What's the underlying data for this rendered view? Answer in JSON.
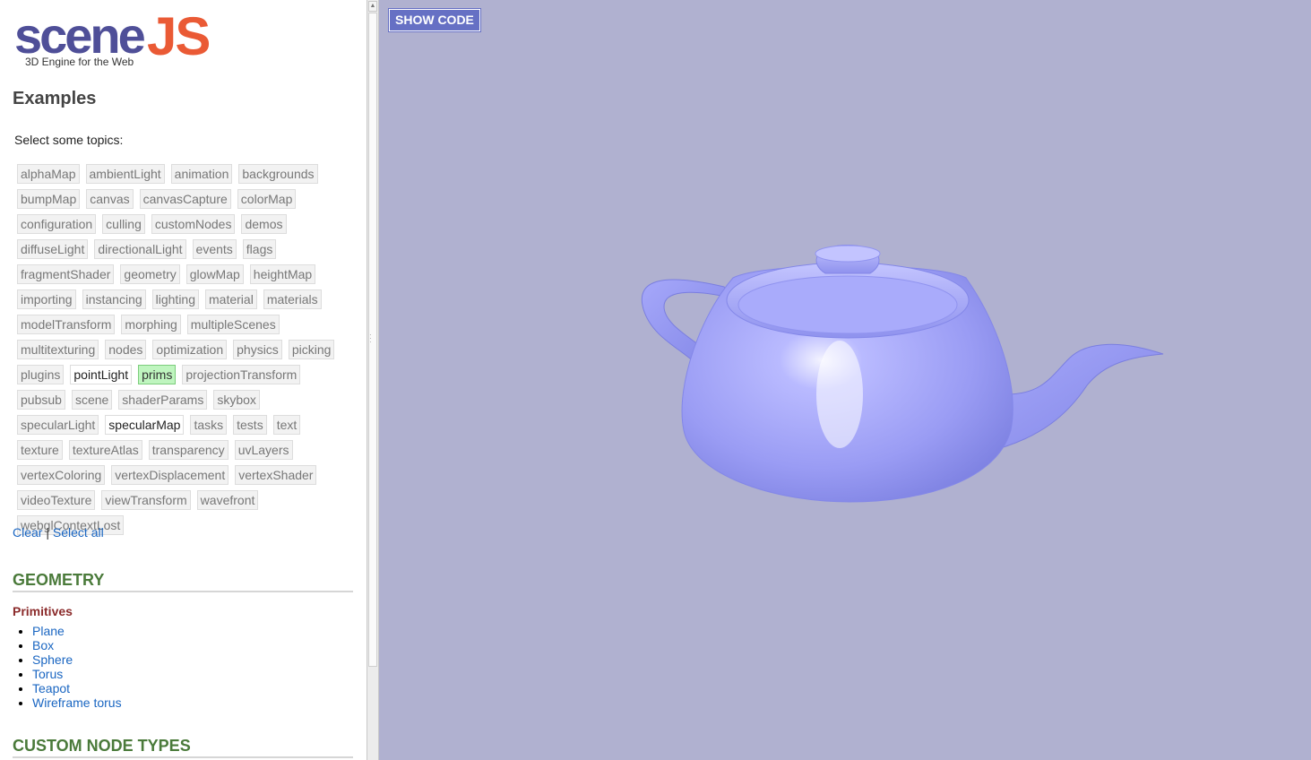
{
  "logo": {
    "scene": "scene",
    "js": "JS",
    "tagline": "3D Engine for the Web"
  },
  "page_title": "Examples",
  "prompt": "Select some topics:",
  "tags": [
    {
      "label": "alphaMap",
      "state": "off"
    },
    {
      "label": "ambientLight",
      "state": "off"
    },
    {
      "label": "animation",
      "state": "off"
    },
    {
      "label": "backgrounds",
      "state": "off"
    },
    {
      "label": "bumpMap",
      "state": "off"
    },
    {
      "label": "canvas",
      "state": "off"
    },
    {
      "label": "canvasCapture",
      "state": "off"
    },
    {
      "label": "colorMap",
      "state": "off"
    },
    {
      "label": "configuration",
      "state": "off"
    },
    {
      "label": "culling",
      "state": "off"
    },
    {
      "label": "customNodes",
      "state": "off"
    },
    {
      "label": "demos",
      "state": "off"
    },
    {
      "label": "diffuseLight",
      "state": "off"
    },
    {
      "label": "directionalLight",
      "state": "off"
    },
    {
      "label": "events",
      "state": "off"
    },
    {
      "label": "flags",
      "state": "off"
    },
    {
      "label": "fragmentShader",
      "state": "off"
    },
    {
      "label": "geometry",
      "state": "off"
    },
    {
      "label": "glowMap",
      "state": "off"
    },
    {
      "label": "heightMap",
      "state": "off"
    },
    {
      "label": "importing",
      "state": "off"
    },
    {
      "label": "instancing",
      "state": "off"
    },
    {
      "label": "lighting",
      "state": "off"
    },
    {
      "label": "material",
      "state": "off"
    },
    {
      "label": "materials",
      "state": "off"
    },
    {
      "label": "modelTransform",
      "state": "off"
    },
    {
      "label": "morphing",
      "state": "off"
    },
    {
      "label": "multipleScenes",
      "state": "off"
    },
    {
      "label": "multitexturing",
      "state": "off"
    },
    {
      "label": "nodes",
      "state": "off"
    },
    {
      "label": "optimization",
      "state": "off"
    },
    {
      "label": "physics",
      "state": "off"
    },
    {
      "label": "picking",
      "state": "off"
    },
    {
      "label": "plugins",
      "state": "off"
    },
    {
      "label": "pointLight",
      "state": "on"
    },
    {
      "label": "prims",
      "state": "selected"
    },
    {
      "label": "projectionTransform",
      "state": "off"
    },
    {
      "label": "pubsub",
      "state": "off"
    },
    {
      "label": "scene",
      "state": "off"
    },
    {
      "label": "shaderParams",
      "state": "off"
    },
    {
      "label": "skybox",
      "state": "off"
    },
    {
      "label": "specularLight",
      "state": "off"
    },
    {
      "label": "specularMap",
      "state": "on"
    },
    {
      "label": "tasks",
      "state": "off"
    },
    {
      "label": "tests",
      "state": "off"
    },
    {
      "label": "text",
      "state": "off"
    },
    {
      "label": "texture",
      "state": "off"
    },
    {
      "label": "textureAtlas",
      "state": "off"
    },
    {
      "label": "transparency",
      "state": "off"
    },
    {
      "label": "uvLayers",
      "state": "off"
    },
    {
      "label": "vertexColoring",
      "state": "off"
    },
    {
      "label": "vertexDisplacement",
      "state": "off"
    },
    {
      "label": "vertexShader",
      "state": "off"
    },
    {
      "label": "videoTexture",
      "state": "off"
    },
    {
      "label": "viewTransform",
      "state": "off"
    },
    {
      "label": "wavefront",
      "state": "off"
    },
    {
      "label": "webglContextLost",
      "state": "off"
    }
  ],
  "links": {
    "clear": "Clear",
    "separator": "|",
    "select_all": "Select all"
  },
  "sections": [
    {
      "title": "GEOMETRY",
      "subhead": "Primitives",
      "items": [
        "Plane",
        "Box",
        "Sphere",
        "Torus",
        "Teapot",
        "Wireframe torus"
      ]
    },
    {
      "title": "CUSTOM NODE TYPES"
    }
  ],
  "viewer": {
    "show_code_label": "SHOW CODE",
    "background": "#b0b1d0",
    "teapot_color": "#9a9cf4"
  }
}
